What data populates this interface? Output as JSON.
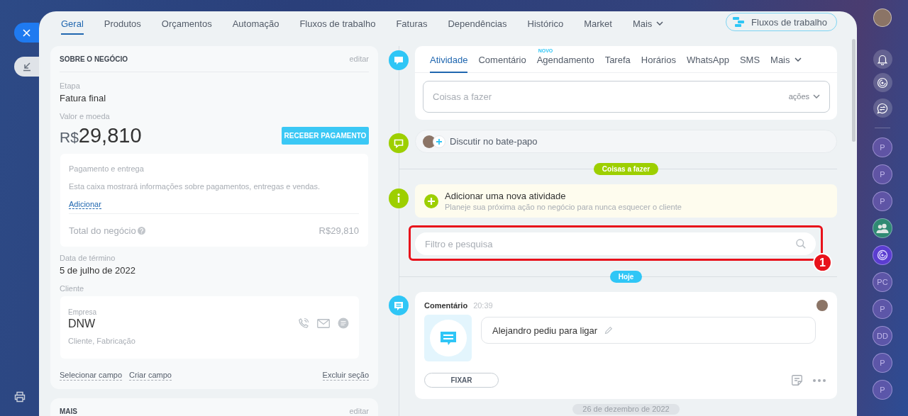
{
  "nav": {
    "tabs": [
      {
        "label": "Geral",
        "selected": true,
        "kind": "tab"
      },
      {
        "label": "Produtos",
        "selected": false,
        "kind": "tab"
      },
      {
        "label": "Orçamentos",
        "selected": false,
        "kind": "tab"
      },
      {
        "label": "Automação",
        "selected": false,
        "kind": "tab"
      },
      {
        "label": "Fluxos de trabalho",
        "selected": false,
        "kind": "tab"
      },
      {
        "label": "Faturas",
        "selected": false,
        "kind": "tab"
      },
      {
        "label": "Dependências",
        "selected": false,
        "kind": "tab"
      },
      {
        "label": "Histórico",
        "selected": false,
        "kind": "tab"
      },
      {
        "label": "Market",
        "selected": false,
        "kind": "tab"
      },
      {
        "label": "Mais",
        "selected": false,
        "kind": "menu"
      }
    ],
    "action_button": "Fluxos de trabalho"
  },
  "deal_card": {
    "title": "SOBRE O NEGÓCIO",
    "edit_link": "editar",
    "stage": {
      "label": "Etapa",
      "value": "Fatura final"
    },
    "amount": {
      "label": "Valor e moeda",
      "currency": "R$",
      "value": "29,810",
      "button": "RECEBER PAGAMENTO"
    },
    "payment_box": {
      "title": "Pagamento e entrega",
      "description": "Esta caixa mostrará informações sobre pagamentos, entregas e vendas.",
      "link": "Adicionar",
      "total_label": "Total do negócio",
      "total_value": "R$29,810"
    },
    "end_date": {
      "label": "Data de término",
      "value": "5 de julho de 2022"
    },
    "client": {
      "label": "Cliente",
      "type_label": "Empresa",
      "name": "DNW",
      "tags": "Cliente, Fabricação"
    },
    "footer_links": [
      "Selecionar campo",
      "Criar campo"
    ],
    "delete_link": "Excluir seção"
  },
  "more_card": {
    "title": "MAIS",
    "edit_link": "editar"
  },
  "timeline": {
    "composer": {
      "tabs": [
        {
          "label": "Atividade",
          "selected": true,
          "kind": "tab"
        },
        {
          "label": "Comentário",
          "selected": false,
          "kind": "tab"
        },
        {
          "label": "Agendamento",
          "selected": false,
          "kind": "tab",
          "badge": "NOVO"
        },
        {
          "label": "Tarefa",
          "selected": false,
          "kind": "tab"
        },
        {
          "label": "Horários",
          "selected": false,
          "kind": "tab"
        },
        {
          "label": "WhatsApp",
          "selected": false,
          "kind": "tab"
        },
        {
          "label": "SMS",
          "selected": false,
          "kind": "tab"
        },
        {
          "label": "Mais",
          "selected": false,
          "kind": "menu"
        }
      ],
      "input": {
        "placeholder": "Coisas a fazer"
      },
      "actions": "ações"
    },
    "chat_bar": "Discutir no bate-papo",
    "todo_divider": "Coisas a fazer",
    "add_activity": {
      "title": "Adicionar uma nova atividade",
      "subtitle": "Planeje sua próxima ação no negócio para nunca esquecer o cliente"
    },
    "filter": {
      "placeholder": "Filtro e pesquisa",
      "callout": {
        "number": "1"
      }
    },
    "today_divider": "Hoje",
    "comment": {
      "type": "Comentário",
      "time": "20:39",
      "text": "Alejandro pediu para ligar",
      "pin_button": "FIXAR"
    },
    "date_divider": "26 de dezembro de 2022"
  },
  "right_rail": {
    "chats": [
      {
        "kind": "initials",
        "label": "P"
      },
      {
        "kind": "initials",
        "label": "P"
      },
      {
        "kind": "initials",
        "label": "P"
      },
      {
        "kind": "group"
      },
      {
        "kind": "logo"
      },
      {
        "kind": "initials",
        "label": "PC"
      },
      {
        "kind": "initials",
        "label": "P"
      },
      {
        "kind": "initials",
        "label": "DD"
      },
      {
        "kind": "initials",
        "label": "P"
      },
      {
        "kind": "initials",
        "label": "P"
      }
    ]
  }
}
